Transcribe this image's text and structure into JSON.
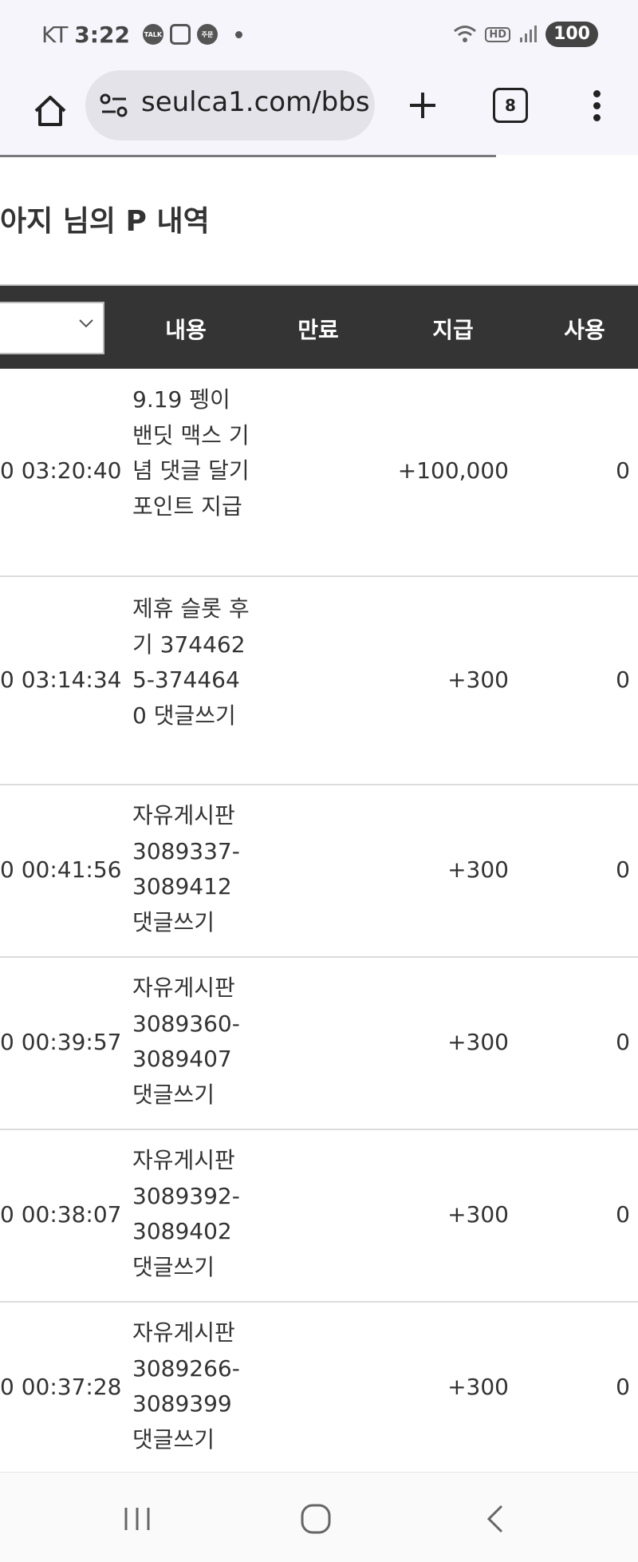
{
  "status_bar": {
    "carrier": "KT",
    "time": "3:22",
    "notif_talk": "TALK",
    "notif_order": "주문",
    "battery": "100",
    "hd_label": "HD"
  },
  "browser": {
    "url": "seulca1.com/bbs",
    "tab_count": "8"
  },
  "page": {
    "title": "아지 님의 P 내역"
  },
  "table": {
    "headers": {
      "content": "내용",
      "expire": "만료",
      "pay": "지급",
      "use": "사용"
    },
    "rows": [
      {
        "time": "0 03:20:40",
        "desc": "9.19 펭이 밴딧 맥스 기념 댓글 달기 포인트 지급",
        "pay": "+100,000",
        "use": "0"
      },
      {
        "time": "0 03:14:34",
        "desc": "제휴 슬롯 후기 3744625-3744640 댓글쓰기",
        "pay": "+300",
        "use": "0"
      },
      {
        "time": "0 00:41:56",
        "desc": "자유게시판 3089337-3089412 댓글쓰기",
        "pay": "+300",
        "use": "0"
      },
      {
        "time": "0 00:39:57",
        "desc": "자유게시판 3089360-3089407 댓글쓰기",
        "pay": "+300",
        "use": "0"
      },
      {
        "time": "0 00:38:07",
        "desc": "자유게시판 3089392-3089402 댓글쓰기",
        "pay": "+300",
        "use": "0"
      },
      {
        "time": "0 00:37:28",
        "desc": "자유게시판 3089266-3089399 댓글쓰기",
        "pay": "+300",
        "use": "0"
      }
    ]
  }
}
